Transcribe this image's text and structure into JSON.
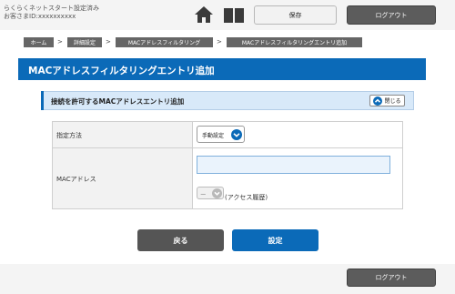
{
  "header": {
    "setup_status": "らくらくネットスタート設定済み",
    "customer_id_label": "お客さまID:",
    "customer_id_value": "xxxxxxxxxx",
    "save_label": "保存",
    "logout_label": "ログアウト"
  },
  "breadcrumb": [
    "ホーム",
    "詳細設定",
    "MACアドレスフィルタリング",
    "MACアドレスフィルタリングエントリ追加"
  ],
  "breadcrumb_separator": ">",
  "page": {
    "title": "MACアドレスフィルタリングエントリ追加",
    "section_title": "接続を許可するMACアドレスエントリ追加",
    "close_label": "閉じる"
  },
  "form": {
    "method_label": "指定方法",
    "method_value": "手動設定",
    "mac_label": "MACアドレス",
    "mac_value": "",
    "history_select_value": "ー",
    "history_label": "(アクセス履歴)"
  },
  "actions": {
    "back_label": "戻る",
    "submit_label": "設定"
  },
  "footer": {
    "logout_label": "ログアウト"
  },
  "colors": {
    "accent_blue": "#0b6ab8",
    "dark_button": "#555555",
    "light_section": "#d8e9f9"
  },
  "icons": [
    "home-icon",
    "book-icon",
    "chevron-up-icon",
    "chevron-down-icon"
  ]
}
